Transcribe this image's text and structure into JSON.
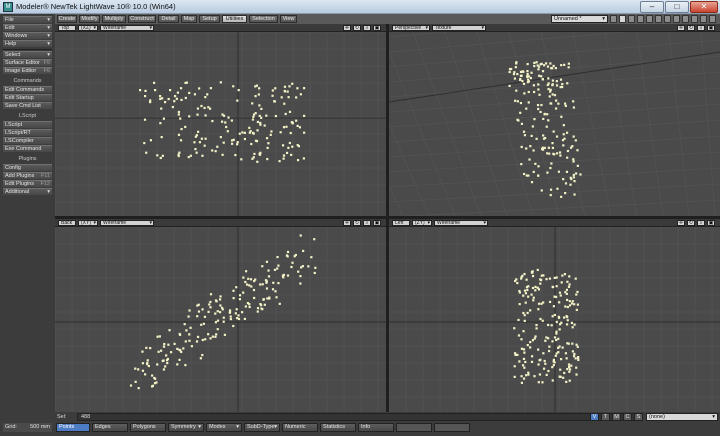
{
  "window": {
    "title": "Modeler® NewTek LightWave 10® 10.0 (Win64)",
    "icon_text": "M",
    "minimize_glyph": "–",
    "maximize_glyph": "□",
    "close_glyph": "✕"
  },
  "left_panel": {
    "menus": [
      {
        "label": "File",
        "arrow": "▾"
      },
      {
        "label": "Edit",
        "arrow": "▾"
      },
      {
        "label": "Windows",
        "arrow": "▾"
      },
      {
        "label": "Help",
        "arrow": "▾"
      }
    ],
    "select": {
      "label": "Select",
      "arrow": "▾"
    },
    "editors": [
      {
        "label": "Surface Editor",
        "shortcut": "F5"
      },
      {
        "label": "Image Editor",
        "shortcut": "F6"
      }
    ],
    "commands_header": "Commands",
    "commands": [
      "Edit Commands",
      "Edit Startup",
      "Save Cmd List"
    ],
    "lscript_header": "LScript",
    "lscript": [
      "LScript",
      "LScript/RT",
      "LSCompiler",
      "Exe Command"
    ],
    "plugins_header": "Plugins",
    "plugins": [
      {
        "label": "Config",
        "shortcut": ""
      },
      {
        "label": "Add Plugins",
        "shortcut": "F11"
      },
      {
        "label": "Edit Plugins",
        "shortcut": "F12"
      }
    ],
    "additional": {
      "label": "Additional",
      "arrow": "▾"
    },
    "grid_label": "Grid:",
    "grid_value": "500 mm"
  },
  "tabs": [
    "Create",
    "Modify",
    "Multiply",
    "Construct",
    "Detail",
    "Map",
    "Setup",
    "Utilities",
    "Selection",
    "View"
  ],
  "active_tab": "Utilities",
  "layer_dropdown": {
    "value": "Unnamed *",
    "arrow": "▾"
  },
  "viewports": [
    {
      "name": "top",
      "view": "Top",
      "axes": "(XZ)",
      "mode": "Wireframe",
      "arrow": "▾"
    },
    {
      "name": "perspective",
      "view": "Perspective",
      "axes": "",
      "mode": "Texture",
      "arrow": "▾"
    },
    {
      "name": "back",
      "view": "Back",
      "axes": "(XY)",
      "mode": "Wireframe",
      "arrow": "▾"
    },
    {
      "name": "left",
      "view": "Left",
      "axes": "(ZY)",
      "mode": "Wireframe",
      "arrow": "▾"
    }
  ],
  "viewport_tools": {
    "move": "✛",
    "rotate": "↻",
    "zoom": "⌕",
    "maximize": "▣"
  },
  "status": {
    "sel_label": "Sel:",
    "sel_count": "488",
    "view_buttons": [
      "V",
      "T",
      "M",
      "C",
      "S"
    ],
    "active_view_button": "V",
    "none_dropdown": "(none)",
    "arrow": "▾"
  },
  "bottom_modes": [
    {
      "label": "Points",
      "arrow": ""
    },
    {
      "label": "Edges",
      "arrow": ""
    },
    {
      "label": "Polygons",
      "arrow": ""
    },
    {
      "label": "Symmetry",
      "arrow": "▾"
    },
    {
      "label": "Modes",
      "arrow": "▾"
    },
    {
      "label": "SubD-Type",
      "arrow": "▾"
    },
    {
      "label": "Numeric",
      "arrow": ""
    },
    {
      "label": "Statistics",
      "arrow": ""
    },
    {
      "label": "Info",
      "arrow": ""
    }
  ],
  "active_mode": "Points",
  "colors": {
    "point": "#f3f1c6",
    "grid_line": "#565656",
    "axis_line": "#2f2f2f",
    "viewport_bg": "#4a4a4a",
    "active_blue": "#4e7cc4"
  }
}
